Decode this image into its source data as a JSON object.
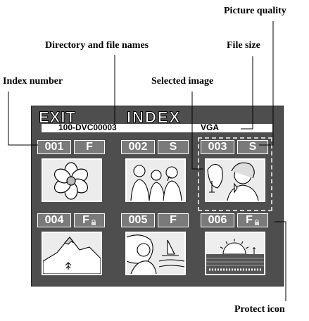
{
  "callouts": {
    "picture_quality": "Picture quality",
    "dir_file_names": "Directory and file names",
    "file_size": "File size",
    "index_number": "Index number",
    "selected_image": "Selected image",
    "protect_icon": "Protect icon"
  },
  "screen": {
    "exit_label": "EXIT",
    "title": "INDEX",
    "file_name": "100-DVC00003",
    "file_size_value": "VGA",
    "thumbnails": [
      {
        "index": "001",
        "quality": "F",
        "protected": false,
        "image": "flower"
      },
      {
        "index": "002",
        "quality": "S",
        "protected": false,
        "image": "people"
      },
      {
        "index": "003",
        "quality": "S",
        "protected": false,
        "image": "woman-drinking",
        "selected": true
      },
      {
        "index": "004",
        "quality": "F",
        "protected": true,
        "image": "mountain"
      },
      {
        "index": "005",
        "quality": "F",
        "protected": false,
        "image": "woman-beach"
      },
      {
        "index": "006",
        "quality": "F",
        "protected": true,
        "image": "sunset"
      }
    ]
  }
}
